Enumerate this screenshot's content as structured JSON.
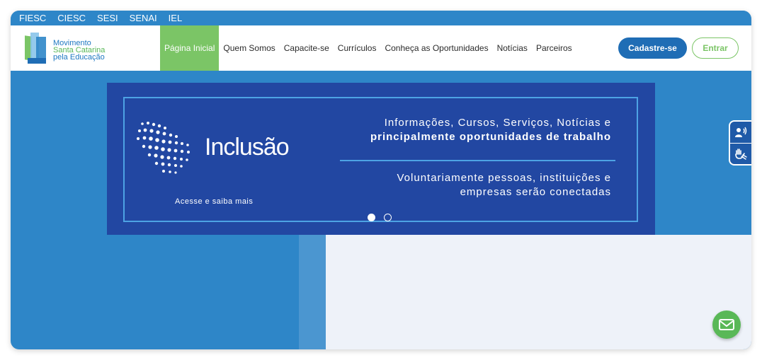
{
  "topbar": {
    "links": [
      "FIESC",
      "CIESC",
      "SESI",
      "SENAI",
      "IEL"
    ]
  },
  "logo": {
    "lines": [
      "Movimento",
      "Santa Catarina",
      "pela Educação"
    ]
  },
  "nav": {
    "items": [
      "Página Inicial",
      "Quem Somos",
      "Capacite-se",
      "Currículos",
      "Conheça as Oportunidades",
      "Notícias",
      "Parceiros"
    ],
    "active_index": 0
  },
  "buttons": {
    "signup": "Cadastre-se",
    "login": "Entrar"
  },
  "banner": {
    "brand": "Inclusão",
    "cta": "Acesse e saiba mais",
    "line1": "Informações, Cursos, Serviços, Notícias e",
    "line2": "principalmente oportunidades de trabalho",
    "line3": "Voluntariamente pessoas, instituições e",
    "line4": "empresas serão conectadas",
    "slides": 2,
    "active_slide": 0
  },
  "accessibility": {
    "icons": [
      "audio-reader-icon",
      "sign-language-icon"
    ]
  },
  "colors": {
    "primary": "#2e86c8",
    "dark_blue": "#2247a2",
    "green": "#7bc566",
    "button_blue": "#1f6db5"
  },
  "chat": {
    "icon": "mail-icon"
  }
}
